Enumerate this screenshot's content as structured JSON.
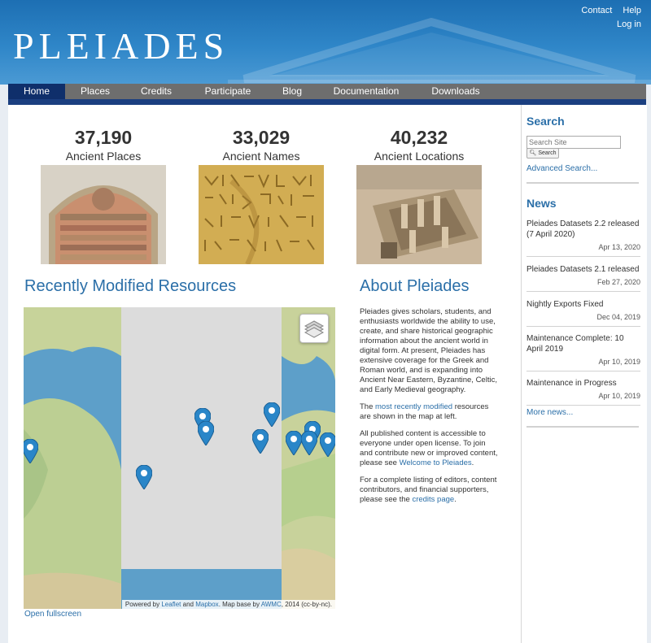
{
  "brand": {
    "logo_text": "PLEIADES"
  },
  "header_links": {
    "contact": "Contact",
    "help": "Help",
    "login": "Log in"
  },
  "nav": {
    "items": [
      {
        "label": "Home",
        "active": true
      },
      {
        "label": "Places"
      },
      {
        "label": "Credits"
      },
      {
        "label": "Participate"
      },
      {
        "label": "Blog"
      },
      {
        "label": "Documentation"
      },
      {
        "label": "Downloads"
      }
    ]
  },
  "stats": [
    {
      "number": "37,190",
      "label": "Ancient Places",
      "image": "mosaic-photo"
    },
    {
      "number": "33,029",
      "label": "Ancient Names",
      "image": "inscription-photo"
    },
    {
      "number": "40,232",
      "label": "Ancient Locations",
      "image": "ruins-photo"
    }
  ],
  "recent": {
    "title": "Recently Modified Resources",
    "attribution": {
      "powered_by": "Powered by",
      "leaflet": "Leaflet",
      "and": "and",
      "mapbox": "Mapbox",
      "map_base": ". Map base by",
      "awmc": "AWMC",
      "rest": ", 2014 (cc-by-nc)."
    },
    "open_fullscreen": "Open fullscreen"
  },
  "about": {
    "title": "About Pleiades",
    "p1": "Pleiades gives scholars, students, and enthusiasts worldwide the ability to use, create, and share historical geographic information about the ancient world in digital form. At present, Pleiades has extensive coverage for the Greek and Roman world, and is expanding into Ancient Near Eastern, Byzantine, Celtic, and Early Medieval geography.",
    "p2_before": "The",
    "p2_link": "most recently modified",
    "p2_after": "resources are shown in the map at left.",
    "p3_before": "All published content is accessible to everyone under open license. To join and contribute new or improved content, please see",
    "p3_link": "Welcome to Pleiades",
    "p3_after": ".",
    "p4_before": "For a complete listing of editors, content contributors, and financial supporters, please see the",
    "p4_link": "credits page",
    "p4_after": "."
  },
  "sidebar": {
    "search": {
      "title": "Search",
      "placeholder": "Search Site",
      "button": "Search",
      "advanced": "Advanced Search..."
    },
    "news": {
      "title": "News",
      "items": [
        {
          "title": "Pleiades Datasets 2.2 released (7 April 2020)",
          "date": "Apr 13, 2020"
        },
        {
          "title": "Pleiades Datasets 2.1 released",
          "date": "Feb 27, 2020"
        },
        {
          "title": "Nightly Exports Fixed",
          "date": "Dec 04, 2019"
        },
        {
          "title": "Maintenance Complete: 10 April 2019",
          "date": "Apr 10, 2019"
        },
        {
          "title": "Maintenance in Progress",
          "date": "Apr 10, 2019"
        }
      ],
      "more": "More news..."
    }
  },
  "colors": {
    "link": "#2b6fa8",
    "nav_active": "#0f2f6b",
    "nav_bar": "#6e6e6e",
    "marker": "#2a86c8"
  }
}
